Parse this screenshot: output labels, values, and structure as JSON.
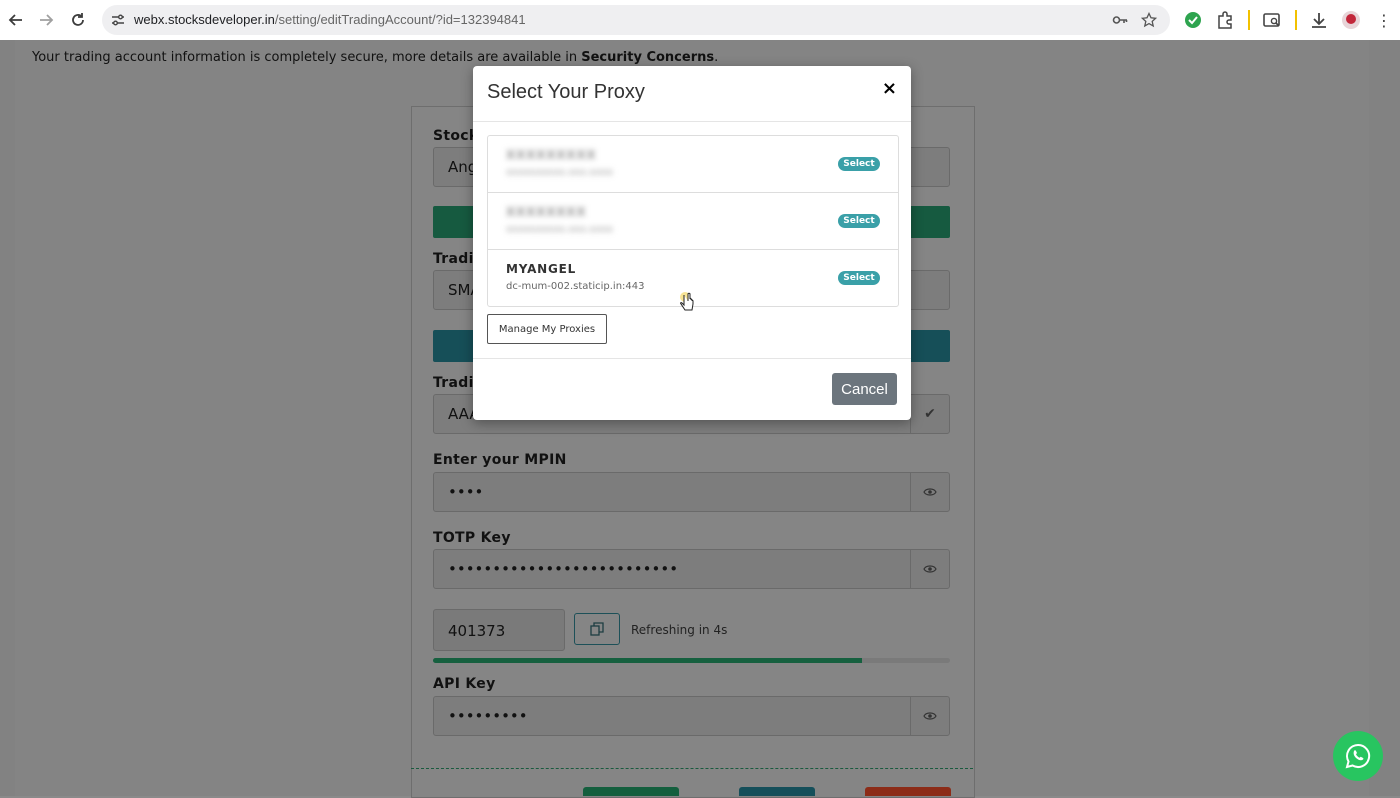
{
  "browser": {
    "url_host": "webx.stocksdeveloper.in",
    "url_path": "/setting/editTradingAccount/?id=132394841"
  },
  "page": {
    "info_text": "Your trading account information is completely secure, more details are available in",
    "info_link": "Security Concerns",
    "info_suffix": ".",
    "stock_label": "Stock",
    "stock_value": "Ang",
    "trading_label_1": "Tradin",
    "trading_value_1": "SMA",
    "trading_label_2": "Tradin",
    "trading_value_2": "AAA",
    "mpin_label": "Enter your MPIN",
    "mpin_value": "••••",
    "totp_label": "TOTP Key",
    "totp_value": "••••••••••••••••••••••••••",
    "otp_value": "401373",
    "refresh_text": "Refreshing in 4s",
    "otp_progress_fraction": 0.83,
    "api_label": "API Key",
    "api_value": "•••••••••"
  },
  "modal": {
    "title": "Select Your Proxy",
    "close": "×",
    "proxies": [
      {
        "name": "XXXXXXXXX",
        "host": "xxxxxxxxxx.xxx.xxxx",
        "select": "Select",
        "blurred": true
      },
      {
        "name": "XXXXXXXX",
        "host": "xxxxxxxxxx.xxx.xxxx",
        "select": "Select",
        "blurred": true
      },
      {
        "name": "MYANGEL",
        "host": "dc-mum-002.staticip.in:443",
        "select": "Select",
        "blurred": false
      }
    ],
    "manage_label": "Manage My Proxies",
    "cancel_label": "Cancel"
  },
  "colors": {
    "select_badge": "#3aa0a8",
    "cancel_button": "#6c757d",
    "whatsapp": "#28c560"
  },
  "icons": [
    "back-icon",
    "forward-icon",
    "reload-icon",
    "site-info-icon",
    "key-icon",
    "star-icon",
    "check-circle-icon",
    "extensions-icon",
    "tab-search-icon",
    "download-icon",
    "avatar",
    "eye-icon",
    "copy-icon",
    "whatsapp-icon"
  ]
}
